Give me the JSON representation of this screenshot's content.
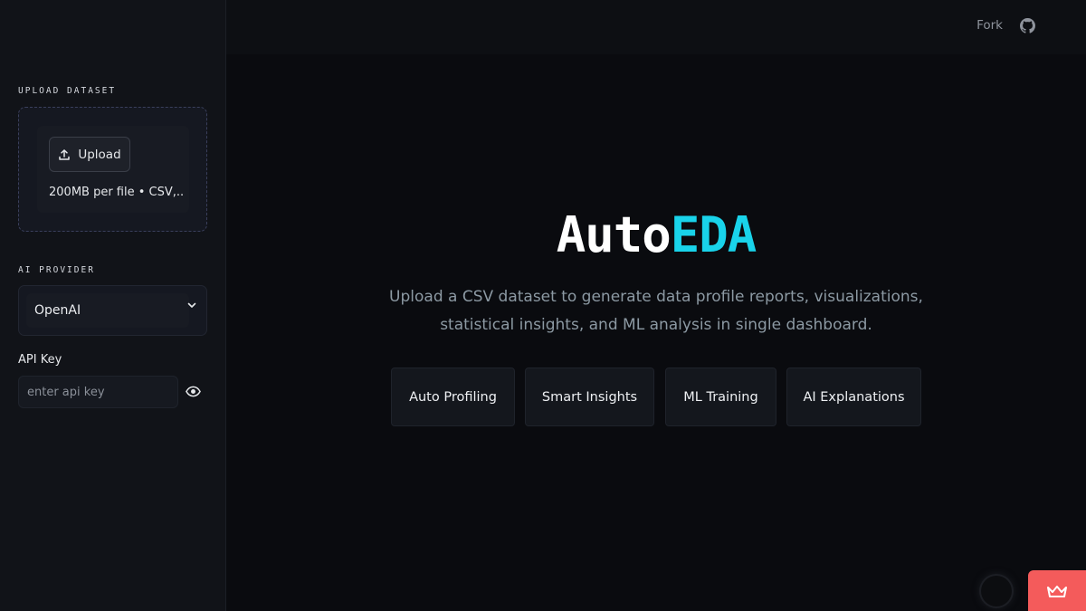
{
  "sidebar": {
    "upload_section_label": "UPLOAD DATASET",
    "upload_button_label": "Upload",
    "upload_limits": "200MB per file • CSV,...",
    "provider_section_label": "AI PROVIDER",
    "provider_selected": "OpenAI",
    "api_key_label": "API Key",
    "api_key_placeholder": "enter api key",
    "api_key_value": ""
  },
  "header": {
    "fork_label": "Fork"
  },
  "hero": {
    "title_prefix": "Auto",
    "title_accent": "EDA",
    "subtitle_line1": "Upload a CSV dataset to generate data profile reports, visualizations,",
    "subtitle_line2": "statistical insights, and ML analysis in single dashboard."
  },
  "features": [
    {
      "label": "Auto Profiling"
    },
    {
      "label": "Smart Insights"
    },
    {
      "label": "ML Training"
    },
    {
      "label": "AI Explanations"
    }
  ],
  "icons": {
    "upload": "upload-icon",
    "chevron": "chevron-down-icon",
    "eye": "eye-icon",
    "github": "github-icon",
    "brand": "crown-icon"
  },
  "colors": {
    "accent": "#19d3ea",
    "brand_badge": "#f45b5b",
    "background": "#0a0b0f",
    "sidebar": "#111318"
  }
}
